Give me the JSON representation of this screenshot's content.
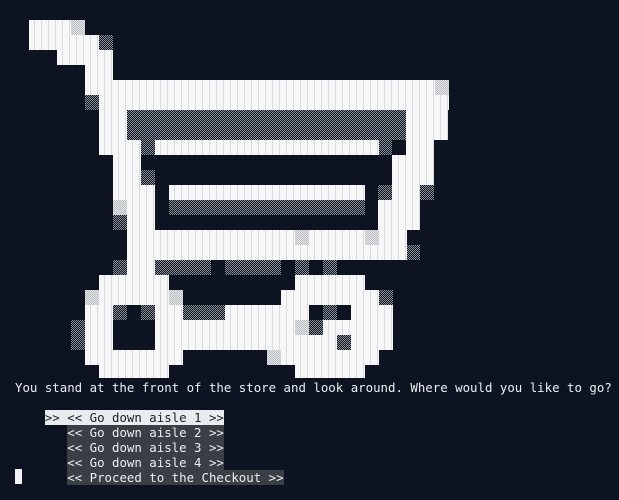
{
  "terminal": {
    "prompt": "You stand at the front of the store and look around. Where would you like to go?",
    "menu": {
      "selected_index": 0,
      "selected_marker": ">> ",
      "unselected_marker": "   ",
      "options": [
        {
          "label": "<< Go down aisle 1 >>"
        },
        {
          "label": "<< Go down aisle 2 >>"
        },
        {
          "label": "<< Go down aisle 3 >>"
        },
        {
          "label": "<< Go down aisle 4 >>"
        },
        {
          "label": "<< Proceed to the Checkout >>"
        }
      ]
    }
  },
  "colors": {
    "background": "#0e1322",
    "art_primary": "#f7f7f7",
    "art_shadow_light": "#cfd2d4",
    "art_shadow_dark": "#5a5d63",
    "menu_unselected_bg": "#3a3f45",
    "menu_selected_bg": "#e8ecef",
    "text": "#eceff1"
  },
  "icons": {
    "art": "shopping-cart-ascii-icon"
  }
}
